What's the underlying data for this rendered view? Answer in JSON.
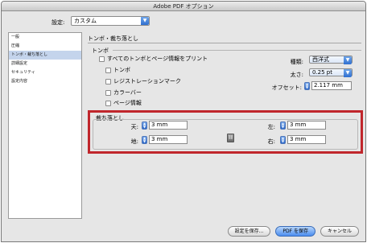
{
  "window": {
    "title": "Adobe PDF オプション"
  },
  "preset": {
    "label": "設定:",
    "value": "カスタム"
  },
  "sidebar": {
    "items": [
      {
        "label": "一般"
      },
      {
        "label": "圧縮"
      },
      {
        "label": "トンボ・裁ち落とし"
      },
      {
        "label": "詳細設定"
      },
      {
        "label": "セキュリティ"
      },
      {
        "label": "設定内容"
      }
    ]
  },
  "panel": {
    "title": "トンボ・裁ち落とし"
  },
  "marks": {
    "group_label": "トンボ",
    "all_marks_label": "すべてのトンボとページ情報をプリント",
    "crop_marks_label": "トンボ",
    "registration_marks_label": "レジストレーションマーク",
    "color_bars_label": "カラーバー",
    "page_info_label": "ページ情報",
    "type_label": "種類:",
    "type_value": "西洋式",
    "weight_label": "太さ:",
    "weight_value": "0.25 pt",
    "offset_label": "オフセット:",
    "offset_value": "2.117 mm"
  },
  "bleed": {
    "group_label": "裁ち落とし",
    "top_label": "天:",
    "top_value": "3 mm",
    "bottom_label": "地:",
    "bottom_value": "3 mm",
    "left_label": "左:",
    "left_value": "3 mm",
    "right_label": "右:",
    "right_value": "3 mm"
  },
  "buttons": {
    "save_settings": "設定を保存...",
    "save_pdf": "PDF を保存",
    "cancel": "キャンセル"
  },
  "colors": {
    "highlight_border": "#c0262c",
    "selection": "#c4d4ec",
    "primary_button": "#4b8df0"
  }
}
